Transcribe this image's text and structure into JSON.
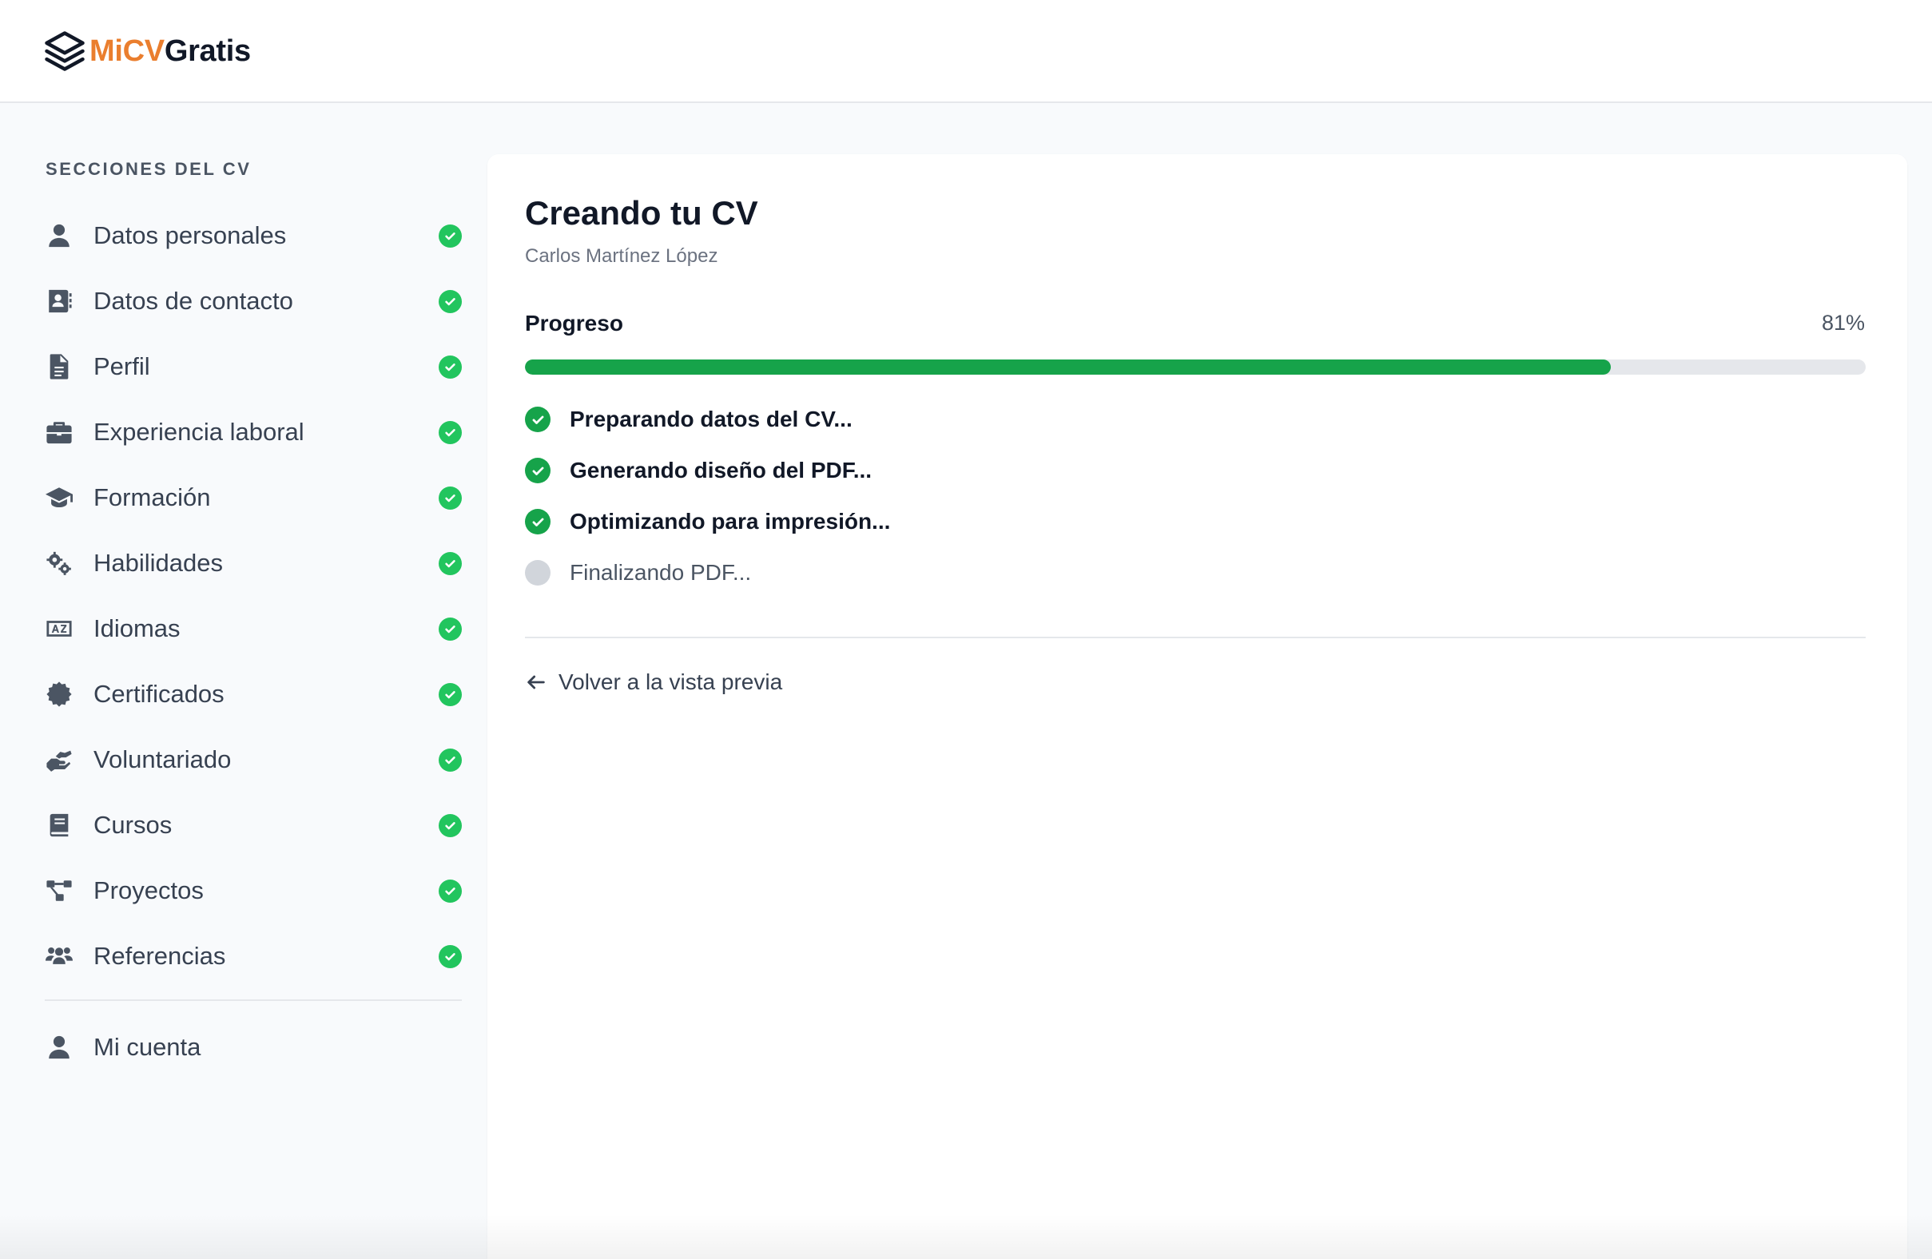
{
  "app": {
    "logo_part1": "MiCV",
    "logo_part2": "Gratis",
    "logo_icon": "layers-icon",
    "brand_color": "#ea7e2e"
  },
  "sidebar": {
    "heading": "SECCIONES DEL CV",
    "items": [
      {
        "label": "Datos personales",
        "icon": "user-icon",
        "complete": true
      },
      {
        "label": "Datos de contacto",
        "icon": "address-book-icon",
        "complete": true
      },
      {
        "label": "Perfil",
        "icon": "document-icon",
        "complete": true
      },
      {
        "label": "Experiencia laboral",
        "icon": "briefcase-icon",
        "complete": true
      },
      {
        "label": "Formación",
        "icon": "graduation-cap-icon",
        "complete": true
      },
      {
        "label": "Habilidades",
        "icon": "gears-icon",
        "complete": true
      },
      {
        "label": "Idiomas",
        "icon": "language-icon",
        "complete": true
      },
      {
        "label": "Certificados",
        "icon": "certificate-icon",
        "complete": true
      },
      {
        "label": "Voluntariado",
        "icon": "hands-helping-icon",
        "complete": true
      },
      {
        "label": "Cursos",
        "icon": "book-icon",
        "complete": true
      },
      {
        "label": "Proyectos",
        "icon": "project-diagram-icon",
        "complete": true
      },
      {
        "label": "Referencias",
        "icon": "users-icon",
        "complete": true
      }
    ],
    "account": {
      "label": "Mi cuenta",
      "icon": "user-icon"
    }
  },
  "main": {
    "title": "Creando tu CV",
    "subtitle": "Carlos Martínez López",
    "progress_label": "Progreso",
    "progress_text": "81%",
    "progress_value": 0.81,
    "progress_color": "#16a34a",
    "steps": [
      {
        "label": "Preparando datos del CV...",
        "done": true
      },
      {
        "label": "Generando diseño del PDF...",
        "done": true
      },
      {
        "label": "Optimizando para impresión...",
        "done": true
      },
      {
        "label": "Finalizando PDF...",
        "done": false
      }
    ],
    "back_label": "Volver a la vista previa"
  }
}
